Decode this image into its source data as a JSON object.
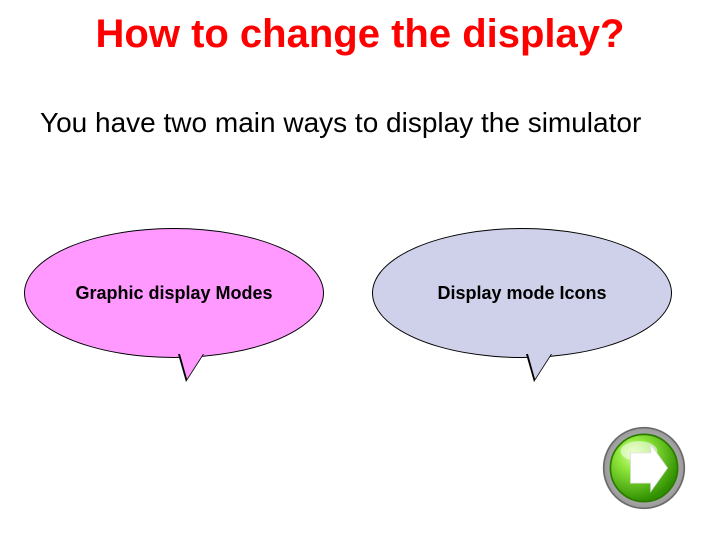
{
  "title": "How to change the display?",
  "body": "You have two main ways to display the simulator",
  "bubbles": {
    "left": {
      "label": "Graphic display Modes"
    },
    "right": {
      "label": "Display mode Icons"
    }
  },
  "nav": {
    "next_icon": "next-arrow"
  },
  "colors": {
    "title": "#ff0000",
    "bubble_left": "#ff99ff",
    "bubble_right": "#cfd1ea",
    "next_button": "#4fc400"
  }
}
